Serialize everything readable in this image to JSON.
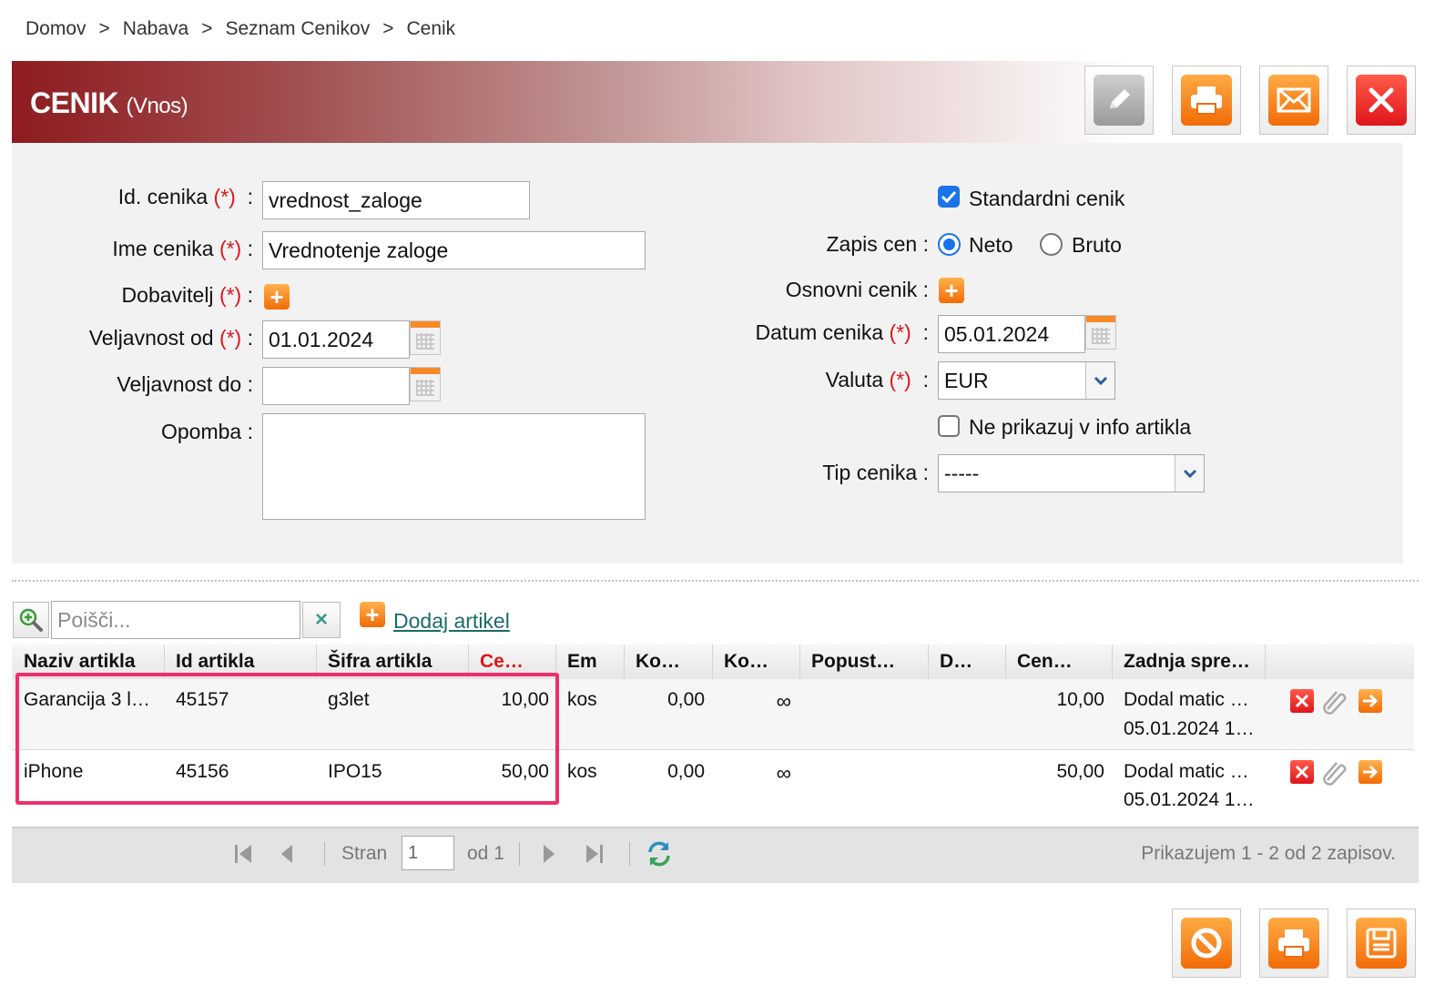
{
  "breadcrumb": [
    "Domov",
    "Nabava",
    "Seznam Cenikov",
    "Cenik"
  ],
  "breadcrumb_separator": ">",
  "header": {
    "title": "CENIK",
    "mode": "(Vnos)"
  },
  "form": {
    "required_mark": "(*)",
    "id_label": "Id. cenika",
    "id_value": "vrednost_zaloge",
    "name_label": "Ime cenika",
    "name_value": "Vrednotenje zaloge",
    "supplier_label": "Dobavitelj",
    "valid_from_label": "Veljavnost od",
    "valid_from_value": "01.01.2024",
    "valid_to_label": "Veljavnost do",
    "valid_to_value": "",
    "note_label": "Opomba",
    "note_value": "",
    "standard_label": "Standardni cenik",
    "standard_checked": true,
    "price_entry_label": "Zapis cen",
    "neto_label": "Neto",
    "bruto_label": "Bruto",
    "price_entry_selected": "Neto",
    "base_list_label": "Osnovni cenik",
    "date_label": "Datum cenika",
    "date_value": "05.01.2024",
    "currency_label": "Valuta",
    "currency_value": "EUR",
    "hide_info_label": "Ne prikazuj v info artikla",
    "hide_info_checked": false,
    "type_label": "Tip cenika",
    "type_value": "-----",
    "colon": ":"
  },
  "grid": {
    "search_placeholder": "Poišči...",
    "add_label": "Dodaj artikel",
    "columns": [
      "Naziv artikla",
      "Id artikla",
      "Šifra artikla",
      "Ce…",
      "Em",
      "Ko…",
      "Ko…",
      "Popust…",
      "D…",
      "Cen…",
      "Zadnja spre…"
    ],
    "rows": [
      {
        "name": "Garancija 3 l…",
        "id": "45157",
        "code": "g3let",
        "price": "10,00",
        "unit": "kos",
        "qty": "0,00",
        "qty2": "∞",
        "discount": "",
        "d": "",
        "final_price": "10,00",
        "changed_1": "Dodal matic …",
        "changed_2": "05.01.2024 1…"
      },
      {
        "name": "iPhone",
        "id": "45156",
        "code": "IPO15",
        "price": "50,00",
        "unit": "kos",
        "qty": "0,00",
        "qty2": "∞",
        "discount": "",
        "d": "",
        "final_price": "50,00",
        "changed_1": "Dodal matic …",
        "changed_2": "05.01.2024 1…"
      }
    ]
  },
  "pager": {
    "page_label": "Stran",
    "page_value": "1",
    "of_label": "od 1",
    "summary": "Prikazujem 1 - 2 od 2 zapisov."
  },
  "colors": {
    "brand": "#8e1b1f",
    "accent_orange": "#f26b07",
    "required": "#e0161b",
    "highlight": "#ee2f6c",
    "checkbox": "#1a73e8"
  }
}
